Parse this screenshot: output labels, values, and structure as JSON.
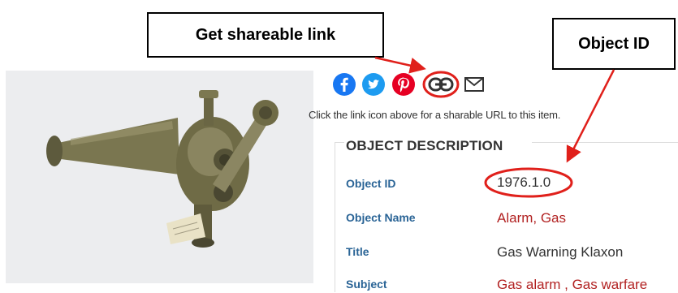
{
  "callouts": {
    "shareable_link": "Get shareable link",
    "object_id": "Object ID"
  },
  "share": {
    "icons": [
      "facebook-icon",
      "twitter-icon",
      "pinterest-icon",
      "link-icon",
      "mail-icon"
    ],
    "hint": "Click the link icon above for a sharable URL to this item."
  },
  "description": {
    "header": "OBJECT DESCRIPTION",
    "rows": [
      {
        "label": "Object ID",
        "value": "1976.1.0"
      },
      {
        "label": "Object Name",
        "value": "Alarm, Gas"
      },
      {
        "label": "Title",
        "value": "Gas Warning Klaxon"
      },
      {
        "label": "Subject",
        "value": "Gas alarm , Gas warfare"
      }
    ]
  },
  "colors": {
    "facebook": "#1877f2",
    "twitter": "#1d9bf0",
    "pinterest": "#e60023",
    "annotation_red": "#e0201b",
    "label_blue": "#2a6496",
    "value_red": "#b22222"
  }
}
